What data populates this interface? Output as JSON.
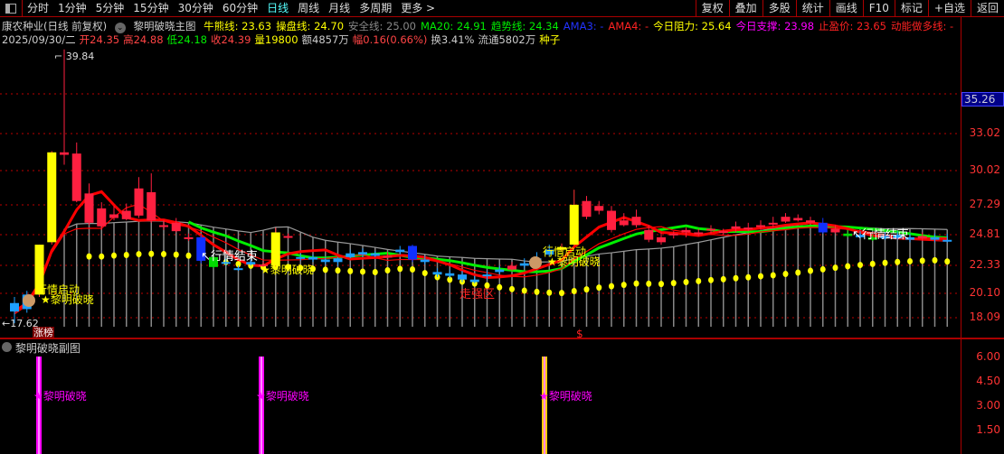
{
  "toolbar": {
    "periods": [
      "分时",
      "1分钟",
      "5分钟",
      "15分钟",
      "30分钟",
      "60分钟",
      "日线",
      "周线",
      "月线",
      "多周期",
      "更多 >"
    ],
    "active": "日线",
    "right_buttons": [
      "复权",
      "叠加",
      "多股",
      "统计",
      "画线",
      "F10",
      "标记",
      "+自选",
      "返回"
    ]
  },
  "indicator_line": {
    "title": "康农种业(日线 前复权)",
    "indicator": "黎明破晓主图",
    "items": [
      {
        "label": "牛熊线: 23.63",
        "color": "#ffff00"
      },
      {
        "label": "操盘线: 24.70",
        "color": "#ffff00"
      },
      {
        "label": "安全线: 25.00",
        "color": "#888888"
      },
      {
        "label": "MA20: 24.91",
        "color": "#00ee00"
      },
      {
        "label": "趋势线: 24.34",
        "color": "#00ee00"
      },
      {
        "label": "AMA3: -",
        "color": "#2233ff"
      },
      {
        "label": "AMA4: -",
        "color": "#ff2222"
      },
      {
        "label": "今日阻力: 25.64",
        "color": "#ffff00"
      },
      {
        "label": "今日支撑: 23.98",
        "color": "#ff00ff"
      },
      {
        "label": "止盈价: 23.65",
        "color": "#ff2222"
      },
      {
        "label": "动能做多线: -",
        "color": "#ff2222"
      }
    ]
  },
  "quote_line": [
    {
      "t": "2025/09/30/二",
      "c": "#cccccc"
    },
    {
      "t": "开24.35",
      "c": "#ff4444"
    },
    {
      "t": "高24.88",
      "c": "#ff4444"
    },
    {
      "t": "低24.18",
      "c": "#00ee00"
    },
    {
      "t": "收24.39",
      "c": "#ff4444"
    },
    {
      "t": "量19800",
      "c": "#ffff00"
    },
    {
      "t": "额4857万",
      "c": "#cccccc"
    },
    {
      "t": "幅0.16(0.66%)",
      "c": "#ff4444"
    },
    {
      "t": "换3.41%",
      "c": "#cccccc"
    },
    {
      "t": "流通5802万",
      "c": "#cccccc"
    },
    {
      "t": "种子",
      "c": "#ffff00"
    }
  ],
  "axis": {
    "current_price": "35.26",
    "ticks": [
      "33.02",
      "30.02",
      "27.29",
      "24.81",
      "22.33",
      "20.10",
      "18.09"
    ],
    "sub_ticks": [
      "6.00",
      "4.50",
      "3.00",
      "1.50"
    ]
  },
  "annotations": {
    "high": "39.84",
    "low": "17.62",
    "start": "行情启动",
    "dawn": "黎明破晓",
    "end": "行情结束",
    "strong": "走强区",
    "limit_list": "涨榜",
    "dollar": "$"
  },
  "sub_panel": {
    "title": "黎明破晓副图",
    "signal": "黎明破晓",
    "signal_indices": [
      2,
      21,
      45
    ]
  },
  "chart_data": {
    "type": "candlestick",
    "candles": [
      [
        19.3,
        19.8,
        17.62,
        18.6,
        "b"
      ],
      [
        18.8,
        20.3,
        18.5,
        20.0,
        "b"
      ],
      [
        20.0,
        24.0,
        19.8,
        24.0,
        "y"
      ],
      [
        24.2,
        31.6,
        24.0,
        31.5,
        "y"
      ],
      [
        31.5,
        39.84,
        30.5,
        31.3,
        "r"
      ],
      [
        31.4,
        32.3,
        27.5,
        27.6,
        "r"
      ],
      [
        28.2,
        29.0,
        25.6,
        25.8,
        "r"
      ],
      [
        27.0,
        27.5,
        25.2,
        25.5,
        "r"
      ],
      [
        26.5,
        27.2,
        26.0,
        26.2,
        "r"
      ],
      [
        26.8,
        27.4,
        26.0,
        26.1,
        "r"
      ],
      [
        28.6,
        29.5,
        26.2,
        26.4,
        "r"
      ],
      [
        28.3,
        29.8,
        25.8,
        26.0,
        "r"
      ],
      [
        25.6,
        26.0,
        25.2,
        25.5,
        "r"
      ],
      [
        25.8,
        26.2,
        25.0,
        25.1,
        "r"
      ],
      [
        24.6,
        24.9,
        24.3,
        24.5,
        "r"
      ],
      [
        24.6,
        24.8,
        22.5,
        22.7,
        "d"
      ],
      [
        23.0,
        23.2,
        22.1,
        22.2,
        "g"
      ],
      [
        22.6,
        22.9,
        22.3,
        22.5,
        "b"
      ],
      [
        22.1,
        22.3,
        21.9,
        22.0,
        "b"
      ],
      [
        22.6,
        22.8,
        22.3,
        22.4,
        "b"
      ],
      [
        22.4,
        22.6,
        22.2,
        22.3,
        "r"
      ],
      [
        22.3,
        25.4,
        22.2,
        25.0,
        "y"
      ],
      [
        24.7,
        24.9,
        24.5,
        24.6,
        "r"
      ],
      [
        23.0,
        23.3,
        22.7,
        22.9,
        "b"
      ],
      [
        23.0,
        23.2,
        22.6,
        22.8,
        "b"
      ],
      [
        22.8,
        23.0,
        22.4,
        22.6,
        "b"
      ],
      [
        22.6,
        23.0,
        22.3,
        22.9,
        "b"
      ],
      [
        23.3,
        23.6,
        22.9,
        23.0,
        "b"
      ],
      [
        23.4,
        23.7,
        23.0,
        23.2,
        "b"
      ],
      [
        23.3,
        23.5,
        23.0,
        23.1,
        "b"
      ],
      [
        23.1,
        23.4,
        22.9,
        23.0,
        "r"
      ],
      [
        23.6,
        23.9,
        23.2,
        23.4,
        "b"
      ],
      [
        23.9,
        24.0,
        22.6,
        22.8,
        "d"
      ],
      [
        22.8,
        23.1,
        22.4,
        22.6,
        "b"
      ],
      [
        21.8,
        22.1,
        21.4,
        21.6,
        "b"
      ],
      [
        21.7,
        22.0,
        21.3,
        21.5,
        "b"
      ],
      [
        21.6,
        21.9,
        21.0,
        21.2,
        "b"
      ],
      [
        21.2,
        21.5,
        20.9,
        21.0,
        "b"
      ],
      [
        21.6,
        21.9,
        21.2,
        21.5,
        "b"
      ],
      [
        22.0,
        22.3,
        21.6,
        21.8,
        "b"
      ],
      [
        22.3,
        22.6,
        21.9,
        22.0,
        "r"
      ],
      [
        22.5,
        22.9,
        22.1,
        22.3,
        "b"
      ],
      [
        22.9,
        23.4,
        22.5,
        22.7,
        "b"
      ],
      [
        23.6,
        24.0,
        23.1,
        23.2,
        "b"
      ],
      [
        23.8,
        24.1,
        23.5,
        23.6,
        "y"
      ],
      [
        24.0,
        28.5,
        23.9,
        27.3,
        "y"
      ],
      [
        27.6,
        28.0,
        26.1,
        26.3,
        "r"
      ],
      [
        27.2,
        27.6,
        26.5,
        26.8,
        "r"
      ],
      [
        26.8,
        27.2,
        25.0,
        25.2,
        "r"
      ],
      [
        26.0,
        26.6,
        25.5,
        25.6,
        "r"
      ],
      [
        26.3,
        26.9,
        25.4,
        25.6,
        "r"
      ],
      [
        25.2,
        25.6,
        24.2,
        24.4,
        "r"
      ],
      [
        24.6,
        25.0,
        24.0,
        24.2,
        "r"
      ],
      [
        24.8,
        25.1,
        24.5,
        24.9,
        "r"
      ],
      [
        25.0,
        25.4,
        24.6,
        25.2,
        "r"
      ],
      [
        24.9,
        25.3,
        24.7,
        25.0,
        "r"
      ],
      [
        25.2,
        25.6,
        24.9,
        25.3,
        "r"
      ],
      [
        25.0,
        25.3,
        24.8,
        25.1,
        "r"
      ],
      [
        25.3,
        25.9,
        25.0,
        25.5,
        "r"
      ],
      [
        25.4,
        25.8,
        25.1,
        25.3,
        "r"
      ],
      [
        25.5,
        26.0,
        25.2,
        25.6,
        "r"
      ],
      [
        25.8,
        26.3,
        25.4,
        25.7,
        "r"
      ],
      [
        26.3,
        26.6,
        25.8,
        25.9,
        "r"
      ],
      [
        26.2,
        26.5,
        25.9,
        26.0,
        "r"
      ],
      [
        26.0,
        26.3,
        25.7,
        25.8,
        "r"
      ],
      [
        25.8,
        26.2,
        24.9,
        25.0,
        "d"
      ],
      [
        25.3,
        25.6,
        24.9,
        25.0,
        "r"
      ],
      [
        24.9,
        25.2,
        24.6,
        24.7,
        "g"
      ],
      [
        24.8,
        25.1,
        24.5,
        24.6,
        "b"
      ],
      [
        24.6,
        24.8,
        24.3,
        24.4,
        "g"
      ],
      [
        24.7,
        25.0,
        24.4,
        24.5,
        "b"
      ],
      [
        24.8,
        25.1,
        24.4,
        24.5,
        "b"
      ],
      [
        24.6,
        24.9,
        24.2,
        24.4,
        "b"
      ],
      [
        24.7,
        25.0,
        24.3,
        24.5,
        "r"
      ],
      [
        24.4,
        24.9,
        24.2,
        24.6,
        "b"
      ],
      [
        24.35,
        24.88,
        24.18,
        24.39,
        "b"
      ]
    ]
  }
}
